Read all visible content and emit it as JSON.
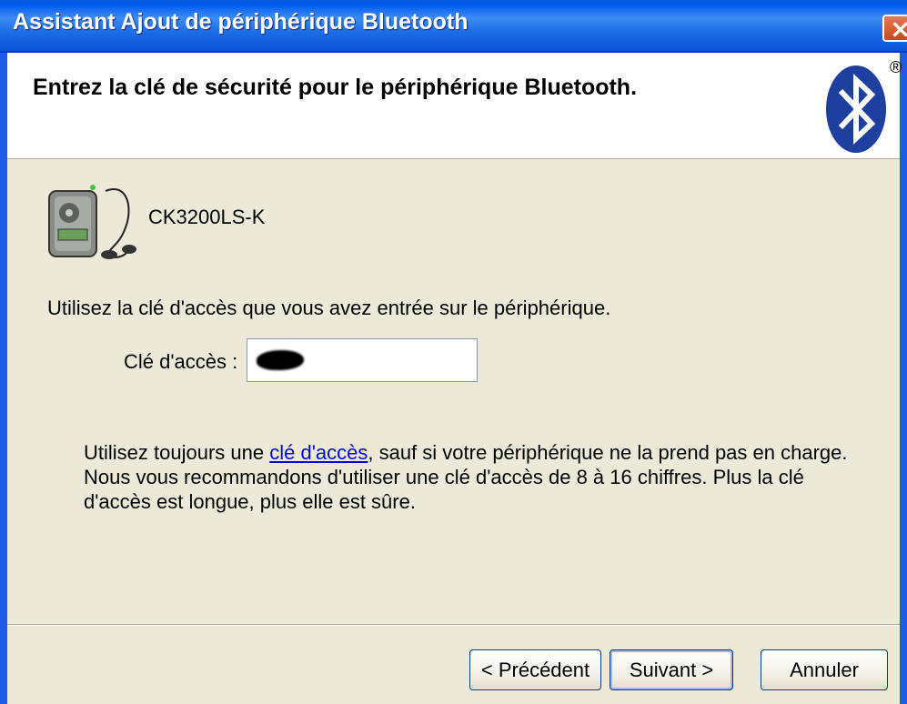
{
  "window": {
    "title": "Assistant Ajout de périphérique Bluetooth",
    "close_icon": "close-icon"
  },
  "header": {
    "title": "Entrez la clé de sécurité pour le périphérique Bluetooth.",
    "logo_icon": "bluetooth-logo-icon",
    "registered_mark": "®"
  },
  "device": {
    "icon": "mp3-player-icon",
    "name": "CK3200LS-K"
  },
  "form": {
    "instruction": "Utilisez la clé d'accès que vous avez entrée sur le périphérique.",
    "key_label": "Clé d'accès :",
    "key_value": ""
  },
  "note": {
    "before_link": "Utilisez toujours une ",
    "link_text": "clé d'accès",
    "after_link": ", sauf si votre périphérique ne la prend pas en charge. Nous vous recommandons d'utiliser une clé d'accès de 8 à 16 chiffres. Plus la clé d'accès est longue, plus elle est sûre."
  },
  "buttons": {
    "previous": "< Précédent",
    "next": "Suivant >",
    "cancel": "Annuler"
  },
  "colors": {
    "titlebar": "#0058ee",
    "dialog_bg": "#ece9d8",
    "link": "#0000ee",
    "bluetooth": "#1e3f9e"
  }
}
